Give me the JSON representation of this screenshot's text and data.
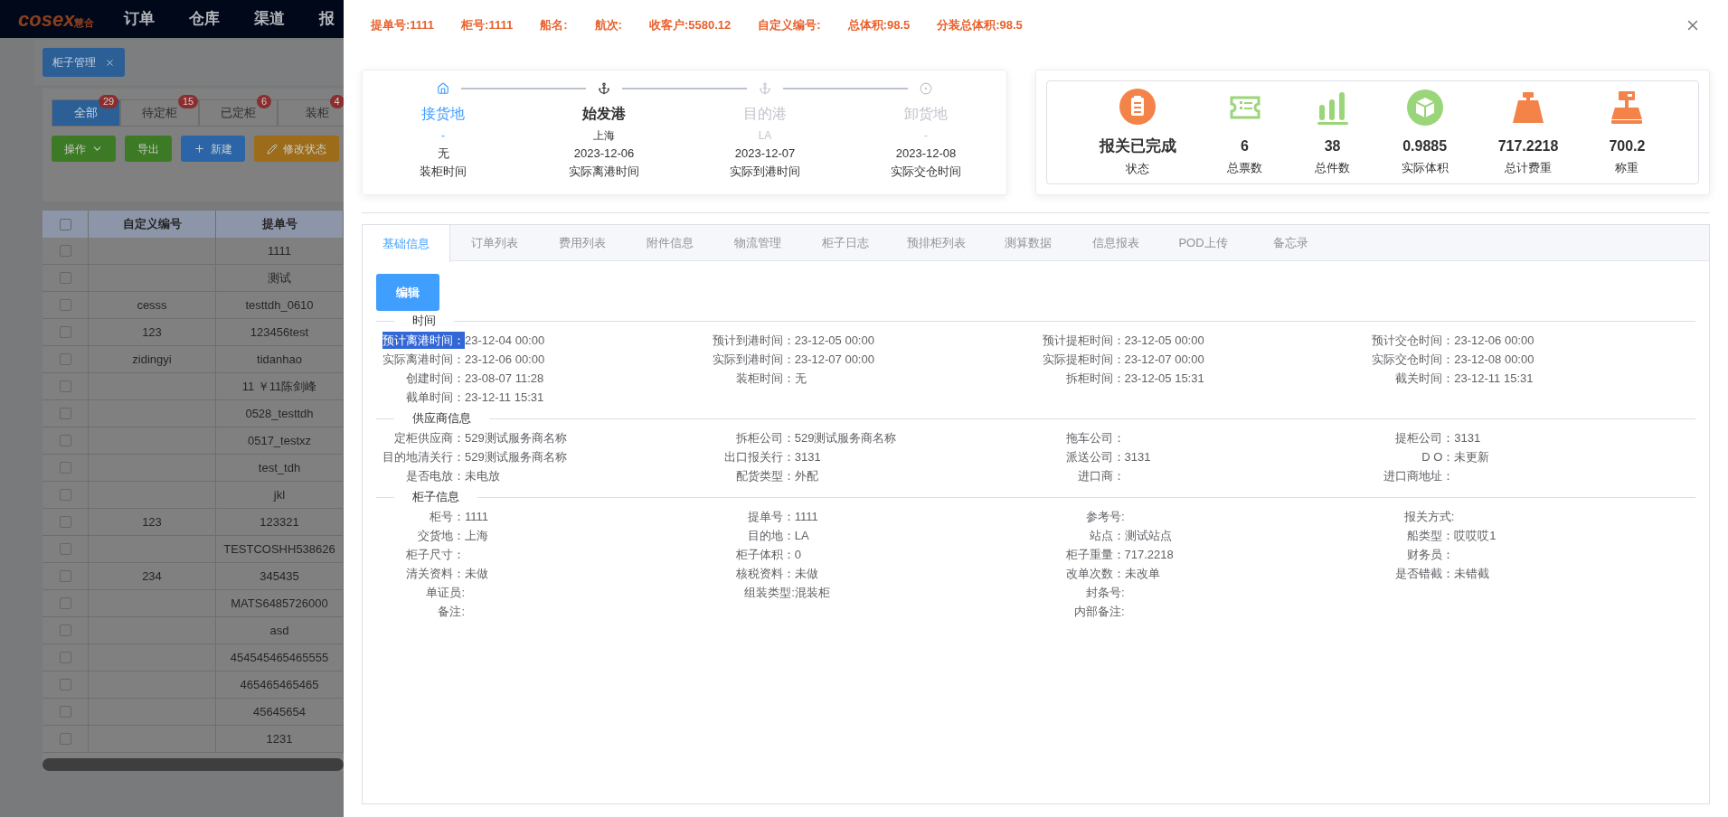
{
  "background": {
    "logo": {
      "text": "cosex",
      "suffix": "慧合"
    },
    "nav": [
      "订单",
      "仓库",
      "渠道",
      "报"
    ],
    "page_tag": "柜子管理",
    "status_tabs": [
      {
        "label": "全部",
        "count": "29",
        "selected": true
      },
      {
        "label": "待定柜",
        "count": "15",
        "selected": false
      },
      {
        "label": "已定柜",
        "count": "6",
        "selected": false
      },
      {
        "label": "装柜",
        "count": "4",
        "selected": false
      }
    ],
    "actions": [
      {
        "label": "操作",
        "kind": "dropdown",
        "color": "#3d7a26"
      },
      {
        "label": "导出",
        "kind": "plain",
        "color": "#3d7a26"
      },
      {
        "label": "新建",
        "kind": "add",
        "color": "#2b65a8"
      },
      {
        "label": "修改状态",
        "kind": "edit",
        "color": "#9c6c1a"
      }
    ],
    "table": {
      "all_checked": false,
      "columns": [
        "自定义编号",
        "提单号"
      ],
      "rows": [
        {
          "checked": false,
          "cells": [
            null,
            "1111"
          ]
        },
        {
          "checked": false,
          "cells": [
            null,
            "测试"
          ]
        },
        {
          "checked": false,
          "cells": [
            "cesss",
            "testtdh_0610"
          ]
        },
        {
          "checked": false,
          "cells": [
            "123",
            "123456test"
          ]
        },
        {
          "checked": false,
          "cells": [
            "zidingyi",
            "tidanhao"
          ]
        },
        {
          "checked": false,
          "cells": [
            null,
            "11 ￥11陈剑峰"
          ]
        },
        {
          "checked": false,
          "cells": [
            null,
            "0528_testtdh"
          ]
        },
        {
          "checked": false,
          "cells": [
            null,
            "0517_testxz"
          ]
        },
        {
          "checked": false,
          "cells": [
            null,
            "test_tdh"
          ]
        },
        {
          "checked": false,
          "cells": [
            null,
            "jkl"
          ]
        },
        {
          "checked": false,
          "cells": [
            "123",
            "123321"
          ]
        },
        {
          "checked": false,
          "cells": [
            null,
            "TESTCOSHH538626"
          ]
        },
        {
          "checked": false,
          "cells": [
            "234",
            "345435"
          ]
        },
        {
          "checked": false,
          "cells": [
            null,
            "MATS6485726000"
          ]
        },
        {
          "checked": false,
          "cells": [
            null,
            "asd"
          ]
        },
        {
          "checked": false,
          "cells": [
            null,
            "454545465465555"
          ]
        },
        {
          "checked": false,
          "cells": [
            null,
            "465465465465"
          ]
        },
        {
          "checked": false,
          "cells": [
            null,
            "45645654"
          ]
        },
        {
          "checked": false,
          "cells": [
            null,
            "1231"
          ]
        }
      ]
    }
  },
  "drawer": {
    "summary": [
      "提单号:1111",
      "柜号:1111",
      "船名:",
      "航次:",
      "收客户:5580.12",
      "自定义编号:",
      "总体积:98.5",
      "分装总体积:98.5"
    ],
    "steps": [
      {
        "title": "接货地",
        "place": "-",
        "date": "无",
        "label": "装柜时间",
        "finished": true,
        "current": false
      },
      {
        "title": "始发港",
        "place": "上海",
        "date": "2023-12-06",
        "label": "实际离港时间",
        "finished": false,
        "current": true
      },
      {
        "title": "目的港",
        "place": "LA",
        "date": "2023-12-07",
        "label": "实际到港时间",
        "finished": false,
        "current": false
      },
      {
        "title": "卸货地",
        "place": "-",
        "date": "2023-12-08",
        "label": "实际交仓时间",
        "finished": false,
        "current": false
      }
    ],
    "stats": [
      {
        "value": "报关已完成",
        "label": "状态",
        "color": "#f4834a"
      },
      {
        "value": "6",
        "label": "总票数",
        "color": "#9bd57a"
      },
      {
        "value": "38",
        "label": "总件数",
        "color": "#9bd57a"
      },
      {
        "value": "0.9885",
        "label": "实际体积",
        "color": "#9bd57a"
      },
      {
        "value": "717.2218",
        "label": "总计费重",
        "color": "#f4834a"
      },
      {
        "value": "700.2",
        "label": "称重",
        "color": "#f4834a"
      }
    ],
    "tabs": [
      {
        "label": "基础信息",
        "selected": true
      },
      {
        "label": "订单列表",
        "selected": false
      },
      {
        "label": "费用列表",
        "selected": false
      },
      {
        "label": "附件信息",
        "selected": false
      },
      {
        "label": "物流管理",
        "selected": false
      },
      {
        "label": "柜子日志",
        "selected": false
      },
      {
        "label": "预排柜列表",
        "selected": false
      },
      {
        "label": "测算数据",
        "selected": false
      },
      {
        "label": "信息报表",
        "selected": false
      },
      {
        "label": "POD上传",
        "selected": false
      },
      {
        "label": "备忘录",
        "selected": false
      }
    ],
    "edit_button": "编辑",
    "sections": [
      {
        "title": "时间",
        "rows": [
          [
            {
              "label": "预计离港时间：",
              "value": "23-12-04 00:00",
              "highlighted": true
            },
            {
              "label": "预计到港时间：",
              "value": "23-12-05 00:00",
              "highlighted": false
            },
            {
              "label": "预计提柜时间：",
              "value": "23-12-05 00:00",
              "highlighted": false
            },
            {
              "label": "预计交仓时间：",
              "value": "23-12-06 00:00",
              "highlighted": false
            }
          ],
          [
            {
              "label": "实际离港时间：",
              "value": "23-12-06 00:00",
              "highlighted": false
            },
            {
              "label": "实际到港时间：",
              "value": "23-12-07 00:00",
              "highlighted": false
            },
            {
              "label": "实际提柜时间：",
              "value": "23-12-07 00:00",
              "highlighted": false
            },
            {
              "label": "实际交仓时间：",
              "value": "23-12-08 00:00",
              "highlighted": false
            }
          ],
          [
            {
              "label": "创建时间：",
              "value": "23-08-07 11:28",
              "highlighted": false
            },
            {
              "label": "装柜时间：",
              "value": "无",
              "highlighted": false
            },
            {
              "label": "拆柜时间：",
              "value": "23-12-05 15:31",
              "highlighted": false
            },
            {
              "label": "截关时间：",
              "value": "23-12-11 15:31",
              "highlighted": false
            }
          ],
          [
            {
              "label": "截单时间：",
              "value": "23-12-11 15:31",
              "highlighted": false
            }
          ]
        ]
      },
      {
        "title": "供应商信息",
        "rows": [
          [
            {
              "label": "定柜供应商：",
              "value": "529测试服务商名称",
              "highlighted": false
            },
            {
              "label": "拆柜公司：",
              "value": "529测试服务商名称",
              "highlighted": false
            },
            {
              "label": "拖车公司：",
              "highlighted": false
            },
            {
              "label": "提柜公司：",
              "value": "3131",
              "highlighted": false
            }
          ],
          [
            {
              "label": "目的地清关行：",
              "value": "529测试服务商名称",
              "highlighted": false
            },
            {
              "label": "出口报关行：",
              "value": "3131",
              "highlighted": false
            },
            {
              "label": "派送公司：",
              "value": "3131",
              "highlighted": false
            },
            {
              "label": "D O：",
              "value": "未更新",
              "highlighted": false
            }
          ],
          [
            {
              "label": "是否电放：",
              "value": "未电放",
              "highlighted": false
            },
            {
              "label": "配货类型：",
              "value": "外配",
              "highlighted": false
            },
            {
              "label": "进口商：",
              "highlighted": false
            },
            {
              "label": "进口商地址：",
              "highlighted": false
            }
          ]
        ]
      },
      {
        "title": "柜子信息",
        "rows": [
          [
            {
              "label": "柜号：",
              "value": "1111",
              "highlighted": false
            },
            {
              "label": "提单号：",
              "value": "1111",
              "highlighted": false
            },
            {
              "label": "参考号:",
              "highlighted": false
            },
            {
              "label": "报关方式:",
              "highlighted": false
            }
          ],
          [
            {
              "label": "交货地：",
              "value": "上海",
              "highlighted": false
            },
            {
              "label": "目的地：",
              "value": "LA",
              "highlighted": false
            },
            {
              "label": "站点：",
              "value": "测试站点",
              "highlighted": false
            },
            {
              "label": "船类型：",
              "value": "哎哎哎1",
              "highlighted": false
            }
          ],
          [
            {
              "label": "柜子尺寸：",
              "highlighted": false
            },
            {
              "label": "柜子体积：",
              "value": "0",
              "highlighted": false
            },
            {
              "label": "柜子重量：",
              "value": "717.2218",
              "highlighted": false
            },
            {
              "label": "财务员：",
              "highlighted": false
            }
          ],
          [
            {
              "label": "清关资料：",
              "value": "未做",
              "highlighted": false
            },
            {
              "label": "核税资料：",
              "value": "未做",
              "highlighted": false
            },
            {
              "label": "改单次数：",
              "value": "未改单",
              "highlighted": false
            },
            {
              "label": "是否错截：",
              "value": "未错截",
              "highlighted": false
            }
          ],
          [
            {
              "label": "单证员:",
              "highlighted": false
            },
            {
              "label": "组装类型:",
              "value": "混装柜",
              "highlighted": false
            },
            {
              "label": "封条号:",
              "highlighted": false
            }
          ],
          [
            {
              "label": "备注:",
              "highlighted": false
            },
            null,
            {
              "label": "内部备注:",
              "highlighted": false
            }
          ]
        ]
      }
    ]
  }
}
